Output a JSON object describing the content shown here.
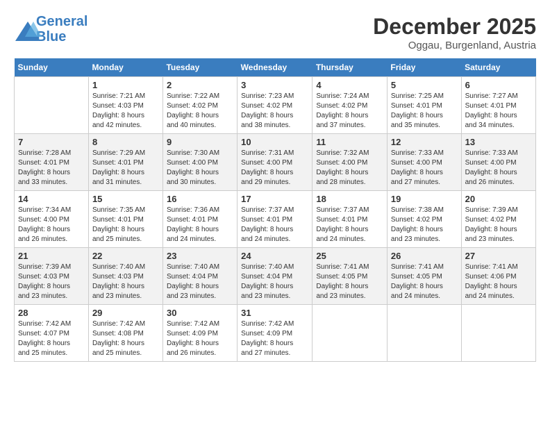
{
  "header": {
    "logo_line1": "General",
    "logo_line2": "Blue",
    "month": "December 2025",
    "location": "Oggau, Burgenland, Austria"
  },
  "weekdays": [
    "Sunday",
    "Monday",
    "Tuesday",
    "Wednesday",
    "Thursday",
    "Friday",
    "Saturday"
  ],
  "weeks": [
    [
      {
        "day": "",
        "info": ""
      },
      {
        "day": "1",
        "info": "Sunrise: 7:21 AM\nSunset: 4:03 PM\nDaylight: 8 hours\nand 42 minutes."
      },
      {
        "day": "2",
        "info": "Sunrise: 7:22 AM\nSunset: 4:02 PM\nDaylight: 8 hours\nand 40 minutes."
      },
      {
        "day": "3",
        "info": "Sunrise: 7:23 AM\nSunset: 4:02 PM\nDaylight: 8 hours\nand 38 minutes."
      },
      {
        "day": "4",
        "info": "Sunrise: 7:24 AM\nSunset: 4:02 PM\nDaylight: 8 hours\nand 37 minutes."
      },
      {
        "day": "5",
        "info": "Sunrise: 7:25 AM\nSunset: 4:01 PM\nDaylight: 8 hours\nand 35 minutes."
      },
      {
        "day": "6",
        "info": "Sunrise: 7:27 AM\nSunset: 4:01 PM\nDaylight: 8 hours\nand 34 minutes."
      }
    ],
    [
      {
        "day": "7",
        "info": "Sunrise: 7:28 AM\nSunset: 4:01 PM\nDaylight: 8 hours\nand 33 minutes."
      },
      {
        "day": "8",
        "info": "Sunrise: 7:29 AM\nSunset: 4:01 PM\nDaylight: 8 hours\nand 31 minutes."
      },
      {
        "day": "9",
        "info": "Sunrise: 7:30 AM\nSunset: 4:00 PM\nDaylight: 8 hours\nand 30 minutes."
      },
      {
        "day": "10",
        "info": "Sunrise: 7:31 AM\nSunset: 4:00 PM\nDaylight: 8 hours\nand 29 minutes."
      },
      {
        "day": "11",
        "info": "Sunrise: 7:32 AM\nSunset: 4:00 PM\nDaylight: 8 hours\nand 28 minutes."
      },
      {
        "day": "12",
        "info": "Sunrise: 7:33 AM\nSunset: 4:00 PM\nDaylight: 8 hours\nand 27 minutes."
      },
      {
        "day": "13",
        "info": "Sunrise: 7:33 AM\nSunset: 4:00 PM\nDaylight: 8 hours\nand 26 minutes."
      }
    ],
    [
      {
        "day": "14",
        "info": "Sunrise: 7:34 AM\nSunset: 4:00 PM\nDaylight: 8 hours\nand 26 minutes."
      },
      {
        "day": "15",
        "info": "Sunrise: 7:35 AM\nSunset: 4:01 PM\nDaylight: 8 hours\nand 25 minutes."
      },
      {
        "day": "16",
        "info": "Sunrise: 7:36 AM\nSunset: 4:01 PM\nDaylight: 8 hours\nand 24 minutes."
      },
      {
        "day": "17",
        "info": "Sunrise: 7:37 AM\nSunset: 4:01 PM\nDaylight: 8 hours\nand 24 minutes."
      },
      {
        "day": "18",
        "info": "Sunrise: 7:37 AM\nSunset: 4:01 PM\nDaylight: 8 hours\nand 24 minutes."
      },
      {
        "day": "19",
        "info": "Sunrise: 7:38 AM\nSunset: 4:02 PM\nDaylight: 8 hours\nand 23 minutes."
      },
      {
        "day": "20",
        "info": "Sunrise: 7:39 AM\nSunset: 4:02 PM\nDaylight: 8 hours\nand 23 minutes."
      }
    ],
    [
      {
        "day": "21",
        "info": "Sunrise: 7:39 AM\nSunset: 4:03 PM\nDaylight: 8 hours\nand 23 minutes."
      },
      {
        "day": "22",
        "info": "Sunrise: 7:40 AM\nSunset: 4:03 PM\nDaylight: 8 hours\nand 23 minutes."
      },
      {
        "day": "23",
        "info": "Sunrise: 7:40 AM\nSunset: 4:04 PM\nDaylight: 8 hours\nand 23 minutes."
      },
      {
        "day": "24",
        "info": "Sunrise: 7:40 AM\nSunset: 4:04 PM\nDaylight: 8 hours\nand 23 minutes."
      },
      {
        "day": "25",
        "info": "Sunrise: 7:41 AM\nSunset: 4:05 PM\nDaylight: 8 hours\nand 23 minutes."
      },
      {
        "day": "26",
        "info": "Sunrise: 7:41 AM\nSunset: 4:05 PM\nDaylight: 8 hours\nand 24 minutes."
      },
      {
        "day": "27",
        "info": "Sunrise: 7:41 AM\nSunset: 4:06 PM\nDaylight: 8 hours\nand 24 minutes."
      }
    ],
    [
      {
        "day": "28",
        "info": "Sunrise: 7:42 AM\nSunset: 4:07 PM\nDaylight: 8 hours\nand 25 minutes."
      },
      {
        "day": "29",
        "info": "Sunrise: 7:42 AM\nSunset: 4:08 PM\nDaylight: 8 hours\nand 25 minutes."
      },
      {
        "day": "30",
        "info": "Sunrise: 7:42 AM\nSunset: 4:09 PM\nDaylight: 8 hours\nand 26 minutes."
      },
      {
        "day": "31",
        "info": "Sunrise: 7:42 AM\nSunset: 4:09 PM\nDaylight: 8 hours\nand 27 minutes."
      },
      {
        "day": "",
        "info": ""
      },
      {
        "day": "",
        "info": ""
      },
      {
        "day": "",
        "info": ""
      }
    ]
  ]
}
